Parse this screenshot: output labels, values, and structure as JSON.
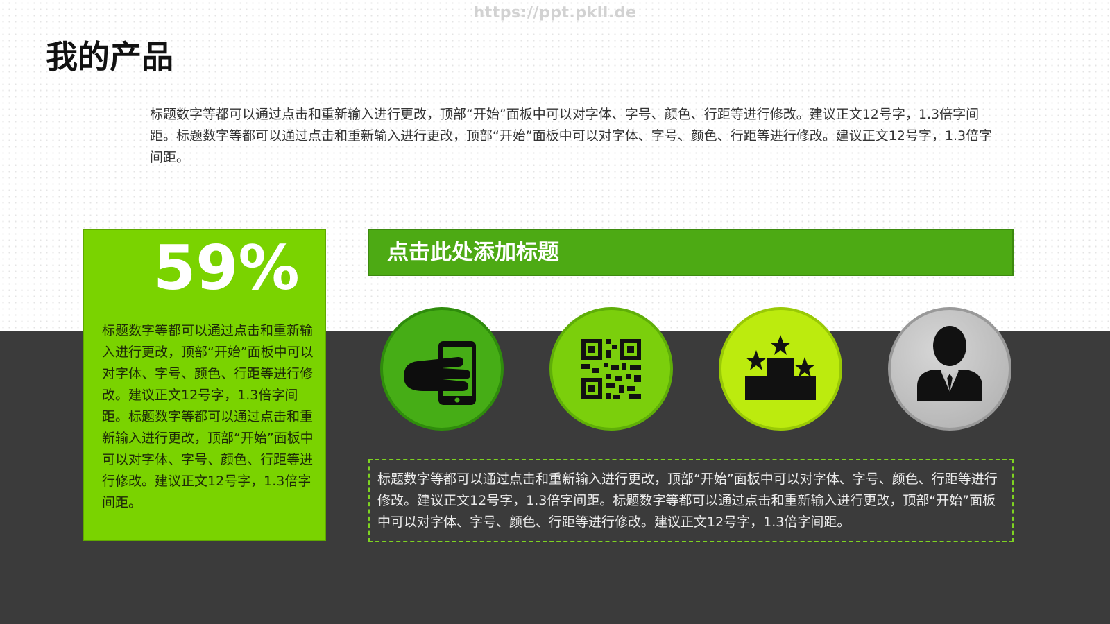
{
  "watermark": "https://ppt.pkll.de",
  "title": "我的产品",
  "intro_text": "标题数字等都可以通过点击和重新输入进行更改，顶部“开始”面板中可以对字体、字号、颜色、行距等进行修改。建议正文12号字，1.3倍字间距。标题数字等都可以通过点击和重新输入进行更改，顶部“开始”面板中可以对字体、字号、颜色、行距等进行修改。建议正文12号字，1.3倍字间距。",
  "stat_card": {
    "value": "59%",
    "text": "标题数字等都可以通过点击和重新输入进行更改，顶部“开始”面板中可以对字体、字号、颜色、行距等进行修改。建议正文12号字，1.3倍字间距。标题数字等都可以通过点击和重新输入进行更改，顶部“开始”面板中可以对字体、字号、颜色、行距等进行修改。建议正文12号字，1.3倍字间距。"
  },
  "banner": {
    "title": "点击此处添加标题"
  },
  "icons": [
    "mobile-payment-icon",
    "qr-code-icon",
    "podium-stars-icon",
    "businessman-icon"
  ],
  "description": "标题数字等都可以通过点击和重新输入进行更改，顶部“开始”面板中可以对字体、字号、颜色、行距等进行修改。建议正文12号字，1.3倍字间距。标题数字等都可以通过点击和重新输入进行更改，顶部“开始”面板中可以对字体、字号、颜色、行距等进行修改。建议正文12号字，1.3倍字间距。",
  "colors": {
    "primary_green": "#7ad300",
    "banner_green": "#4daa14",
    "lime": "#bceb0e",
    "dark_band": "#3b3b3b"
  }
}
